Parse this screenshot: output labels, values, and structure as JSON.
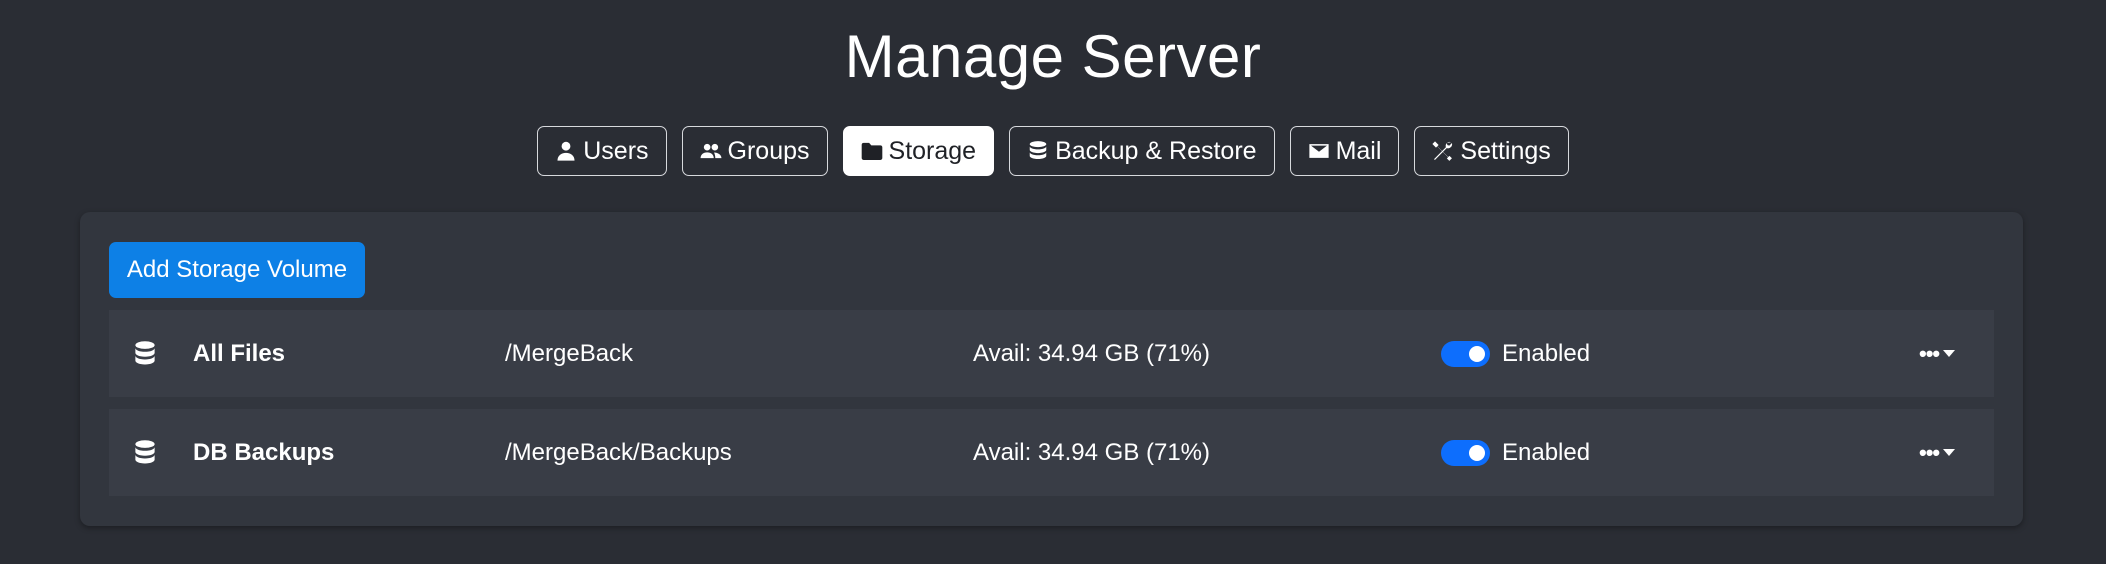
{
  "header": {
    "title": "Manage Server"
  },
  "tabs": [
    {
      "label": "Users",
      "icon": "person-icon",
      "active": false
    },
    {
      "label": "Groups",
      "icon": "people-icon",
      "active": false
    },
    {
      "label": "Storage",
      "icon": "folder-icon",
      "active": true
    },
    {
      "label": "Backup & Restore",
      "icon": "database-icon",
      "active": false
    },
    {
      "label": "Mail",
      "icon": "envelope-icon",
      "active": false
    },
    {
      "label": "Settings",
      "icon": "tools-icon",
      "active": false
    }
  ],
  "storage": {
    "add_button_label": "Add Storage Volume",
    "volumes": [
      {
        "name": "All Files",
        "path": "/MergeBack",
        "avail": "Avail: 34.94 GB (71%)",
        "enabled": true,
        "status": "Enabled",
        "menu": "•••"
      },
      {
        "name": "DB Backups",
        "path": "/MergeBack/Backups",
        "avail": "Avail: 34.94 GB (71%)",
        "enabled": true,
        "status": "Enabled",
        "menu": "•••"
      }
    ]
  },
  "colors": {
    "background": "#2a2d34",
    "card": "#32363e",
    "row": "#393d46",
    "primary_button": "#0d80e6",
    "toggle_on": "#0d6efd"
  }
}
